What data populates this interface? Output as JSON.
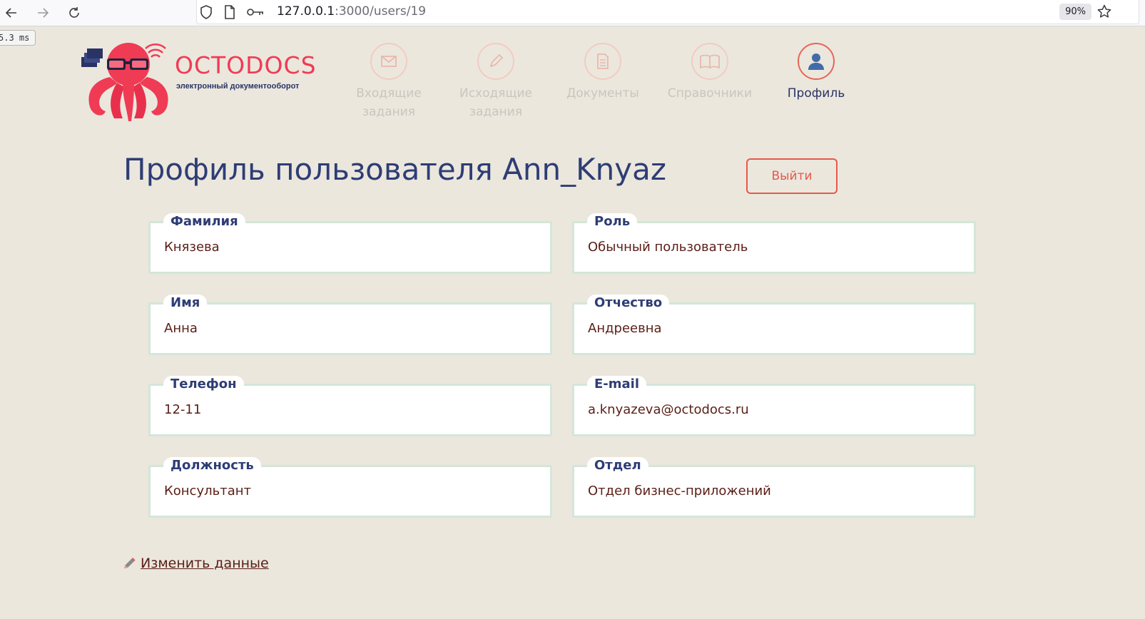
{
  "browser": {
    "url_host": "127.0.0.1",
    "url_path": ":3000/users/19",
    "zoom": "90%",
    "timing": "5.3 ms"
  },
  "logo": {
    "wordmark": "OCTODOCS",
    "tagline": "электронный документооборот"
  },
  "nav": {
    "items": [
      {
        "label_line1": "Входящие",
        "label_line2": "задания",
        "icon": "envelope-icon"
      },
      {
        "label_line1": "Исходящие",
        "label_line2": "задания",
        "icon": "pencil-icon"
      },
      {
        "label_line1": "Документы",
        "label_line2": "",
        "icon": "document-icon"
      },
      {
        "label_line1": "Справочники",
        "label_line2": "",
        "icon": "book-icon"
      },
      {
        "label_line1": "Профиль",
        "label_line2": "",
        "icon": "user-icon"
      }
    ]
  },
  "page": {
    "title": "Профиль пользователя Ann_Knyaz",
    "logout_label": "Выйти",
    "edit_link_label": "Изменить данные"
  },
  "fields": {
    "surname": {
      "label": "Фамилия",
      "value": "Князева"
    },
    "role": {
      "label": "Роль",
      "value": "Обычный пользователь"
    },
    "first_name": {
      "label": "Имя",
      "value": "Анна"
    },
    "patronymic": {
      "label": "Отчество",
      "value": "Андреевна"
    },
    "phone": {
      "label": "Телефон",
      "value": "12-11"
    },
    "email": {
      "label": "E-mail",
      "value": "a.knyazeva@octodocs.ru"
    },
    "position": {
      "label": "Должность",
      "value": "Консультант"
    },
    "department": {
      "label": "Отдел",
      "value": "Отдел бизнес-приложений"
    }
  },
  "colors": {
    "background": "#ebe7dd",
    "accent": "#e8584b",
    "brand_pink": "#f03b55",
    "title_blue": "#2e3d75",
    "value_brown": "#5a1e17"
  }
}
